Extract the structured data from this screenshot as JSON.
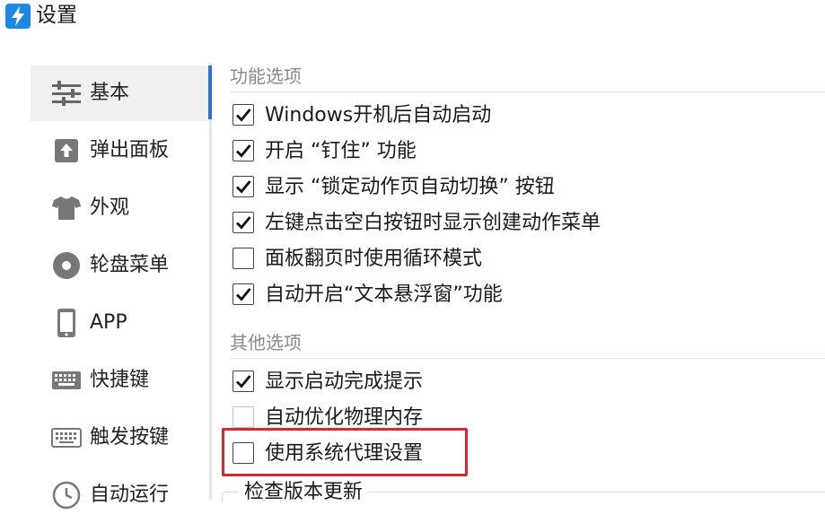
{
  "window": {
    "title": "设置",
    "app_icon": "lightning-bolt-icon",
    "accent": "#2e6fd9"
  },
  "sidebar": {
    "items": [
      {
        "label": "基本",
        "icon": "sliders-icon"
      },
      {
        "label": "弹出面板",
        "icon": "upload-icon"
      },
      {
        "label": "外观",
        "icon": "tshirt-icon"
      },
      {
        "label": "轮盘菜单",
        "icon": "disc-icon"
      },
      {
        "label": "APP",
        "icon": "phone-icon"
      },
      {
        "label": "快捷键",
        "icon": "keyboard-icon"
      },
      {
        "label": "触发按键",
        "icon": "keyboard-icon"
      },
      {
        "label": "自动运行",
        "icon": "clock-icon"
      }
    ],
    "selected": "基本"
  },
  "sections": {
    "features": {
      "title": "功能选项",
      "options": [
        {
          "label": "Windows开机后自动启动",
          "checked": true
        },
        {
          "label": "开启 “钉住” 功能",
          "checked": true
        },
        {
          "label": "显示 “锁定动作页自动切换” 按钮",
          "checked": true
        },
        {
          "label": "左键点击空白按钮时显示创建动作菜单",
          "checked": true
        },
        {
          "label": "面板翻页时使用循环模式",
          "checked": false
        },
        {
          "label": "自动开启“文本悬浮窗”功能",
          "checked": true
        }
      ]
    },
    "other": {
      "title": "其他选项",
      "options": [
        {
          "label": "显示启动完成提示",
          "checked": true
        },
        {
          "label": "自动优化物理内存",
          "checked": false
        },
        {
          "label": "使用系统代理设置",
          "checked": false
        }
      ]
    },
    "update": {
      "title": "检查版本更新"
    }
  },
  "colors": {
    "highlight_box": "#e0242b",
    "section_title": "#8a8a8a",
    "selected_bg": "#f0f0f0"
  }
}
